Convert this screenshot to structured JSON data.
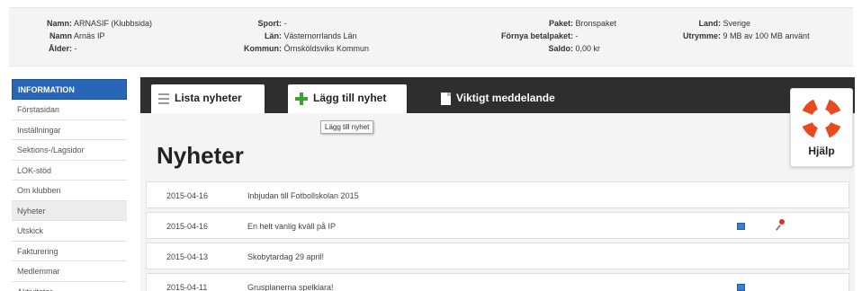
{
  "club_info": {
    "col1": [
      {
        "label": "Namn:",
        "value": "ARNASIF (Klubbsida)"
      },
      {
        "label": "Namn",
        "value": "Arnäs IP"
      },
      {
        "label": "Ålder:",
        "value": "-"
      }
    ],
    "col2": [
      {
        "label": "Sport:",
        "value": "-"
      },
      {
        "label": "Län:",
        "value": "Västernorrlands Län"
      },
      {
        "label": "Kommun:",
        "value": "Örnsköldsviks Kommun"
      }
    ],
    "col3": [
      {
        "label": "Paket:",
        "value": "Bronspaket"
      },
      {
        "label": "Förnya betalpaket:",
        "value": "-"
      },
      {
        "label": "Saldo:",
        "value": "0,00 kr"
      }
    ],
    "col4": [
      {
        "label": "Land:",
        "value": "Sverige"
      },
      {
        "label": "Utrymme:",
        "value": "9 MB av 100 MB använt"
      }
    ]
  },
  "sidebar": {
    "heading": "INFORMATION",
    "items": [
      {
        "label": "Förstasidan"
      },
      {
        "label": "Inställningar"
      },
      {
        "label": "Sektions-/Lagsidor"
      },
      {
        "label": "LOK-stöd"
      },
      {
        "label": "Om klubben"
      },
      {
        "label": "Nyheter"
      },
      {
        "label": "Utskick"
      },
      {
        "label": "Fakturering"
      },
      {
        "label": "Medlemmar"
      },
      {
        "label": "Aktiviteter"
      }
    ],
    "active_index": 5
  },
  "tabs": [
    {
      "label": "Lista nyheter",
      "icon": "list-icon"
    },
    {
      "label": "Lägg till nyhet",
      "icon": "plus-icon"
    },
    {
      "label": "Viktigt meddelande",
      "icon": "document-icon"
    }
  ],
  "tooltip": "Lägg till nyhet",
  "page_title": "Nyheter",
  "help_label": "Hjälp",
  "news": [
    {
      "date": "2015-04-16",
      "title": "Inbjudan till Fotbollskolan 2015",
      "has_image": false,
      "pinned": false
    },
    {
      "date": "2015-04-16",
      "title": "En helt vanlig kväll på IP",
      "has_image": true,
      "pinned": true
    },
    {
      "date": "2015-04-13",
      "title": "Skobytardag 29 april!",
      "has_image": false,
      "pinned": false
    },
    {
      "date": "2015-04-11",
      "title": "Grusplanerna spelklara!",
      "has_image": true,
      "pinned": false
    }
  ],
  "colors": {
    "sidebar_heading": "#2a66b8",
    "tabbar": "#2e2e2e",
    "plus_icon": "#3aa335",
    "help_ring": "#e8491d"
  }
}
